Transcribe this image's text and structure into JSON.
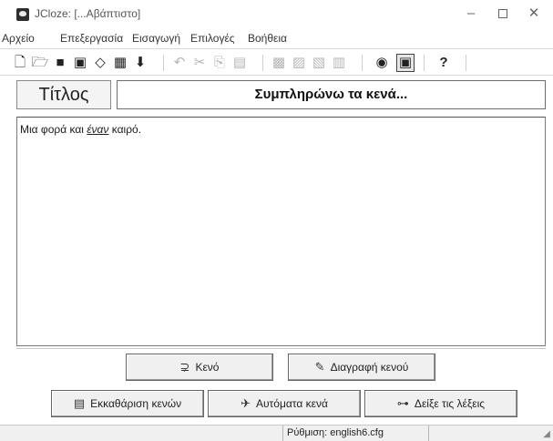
{
  "window": {
    "title": "JCloze: [...Αβάπτιστο]",
    "controls": {
      "minimize": "–",
      "maximize": "",
      "close": "✕"
    }
  },
  "menu": [
    "Αρχείο",
    "Επεξεργασία",
    "Εισαγωγή",
    "Επιλογές",
    "Βοήθεια"
  ],
  "toolbar": {
    "help_label": "?",
    "icons": [
      "new-file-icon",
      "open-folder-icon",
      "save-icon",
      "save-as-icon",
      "clear-icon",
      "web-page-icon",
      "export-icon",
      "undo-icon",
      "cut-icon",
      "copy-icon",
      "paste-icon",
      "gap-options-icon",
      "insert-image-icon",
      "config-icon",
      "config2-icon",
      "edit-icon",
      "view-icon",
      "help-icon"
    ]
  },
  "title_section": {
    "label": "Τίτλος",
    "value": "Συμπληρώνω τα κενά..."
  },
  "editor": {
    "text_before": "Μια φορά και ",
    "gap_word": "έναν",
    "text_after": " καιρό."
  },
  "buttons": {
    "gap": "Κενό",
    "delete_gap": "Διαγραφή κενού",
    "clear_gaps": "Εκκαθάριση κενών",
    "auto_gaps": "Αυτόματα κενά",
    "show_words": "Δείξε τις λέξεις"
  },
  "status": {
    "config": "Ρύθμιση: english6.cfg"
  }
}
